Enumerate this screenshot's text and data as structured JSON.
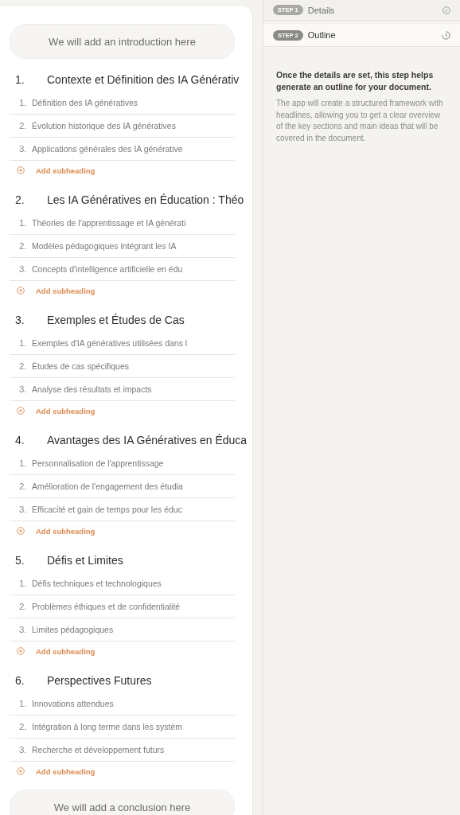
{
  "outline": {
    "introduction": "We will add an introduction here",
    "sections": [
      {
        "number": "1.",
        "title": "Contexte et Définition des IA Générativ",
        "subheadings": [
          {
            "number": "1.",
            "text": "Définition des IA génératives"
          },
          {
            "number": "2.",
            "text": "Évolution historique des IA génératives"
          },
          {
            "number": "3.",
            "text": "Applications générales des IA générative"
          }
        ],
        "add_label": "Add subheading"
      },
      {
        "number": "2.",
        "title": "Les IA Génératives en Éducation : Théo",
        "subheadings": [
          {
            "number": "1.",
            "text": "Théories de l'apprentissage et IA générati"
          },
          {
            "number": "2.",
            "text": "Modèles pédagogiques intégrant les IA"
          },
          {
            "number": "3.",
            "text": "Concepts d'intelligence artificielle en édu"
          }
        ],
        "add_label": "Add subheading"
      },
      {
        "number": "3.",
        "title": "Exemples et Études de Cas",
        "subheadings": [
          {
            "number": "1.",
            "text": "Exemples d'IA génératives utilisées dans l"
          },
          {
            "number": "2.",
            "text": "Études de cas spécifiques"
          },
          {
            "number": "3.",
            "text": "Analyse des résultats et impacts"
          }
        ],
        "add_label": "Add subheading"
      },
      {
        "number": "4.",
        "title": "Avantages des IA Génératives en Éduca",
        "subheadings": [
          {
            "number": "1.",
            "text": "Personnalisation de l'apprentissage"
          },
          {
            "number": "2.",
            "text": "Amélioration de l'engagement des étudia"
          },
          {
            "number": "3.",
            "text": "Efficacité et gain de temps pour les éduc"
          }
        ],
        "add_label": "Add subheading"
      },
      {
        "number": "5.",
        "title": "Défis et Limites",
        "subheadings": [
          {
            "number": "1.",
            "text": "Défis techniques et technologiques"
          },
          {
            "number": "2.",
            "text": "Problèmes éthiques et de confidentialité"
          },
          {
            "number": "3.",
            "text": "Limites pédagogiques"
          }
        ],
        "add_label": "Add subheading"
      },
      {
        "number": "6.",
        "title": "Perspectives Futures",
        "subheadings": [
          {
            "number": "1.",
            "text": "Innovations attendues"
          },
          {
            "number": "2.",
            "text": "Intégration à long terme dans les systèm"
          },
          {
            "number": "3.",
            "text": "Recherche et développement futurs"
          }
        ],
        "add_label": "Add subheading"
      }
    ],
    "conclusion": "We will add a conclusion here"
  },
  "steps": [
    {
      "badge": "STEP 1",
      "label": "Details",
      "done": true,
      "selected": false
    },
    {
      "badge": "STEP 2",
      "label": "Outline",
      "done": false,
      "selected": true
    }
  ],
  "help": {
    "title": "Once the details are set, this step helps generate an outline for your document.",
    "body": "The app will create a structured framework with headlines, allowing you to get a clear overview of the key sections and main ideas that will be covered in the document."
  }
}
